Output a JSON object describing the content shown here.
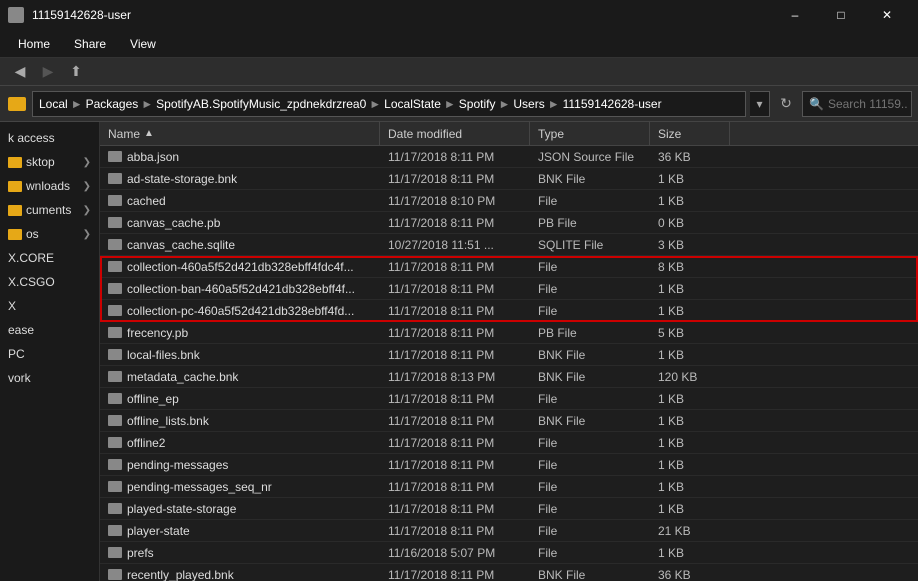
{
  "titleBar": {
    "icon": "folder",
    "title": "11159142628-user",
    "controls": [
      "minimize",
      "maximize",
      "close"
    ]
  },
  "menuBar": {
    "items": [
      "Home",
      "Share",
      "View"
    ]
  },
  "toolbar": {
    "label": "File Explorer Toolbar"
  },
  "addressBar": {
    "parts": [
      "Local",
      "Packages",
      "SpotifyAB.SpotifyMusic_zpdnekdrzrea0",
      "LocalState",
      "Spotify",
      "Users",
      "11159142628-user"
    ],
    "search_placeholder": "Search 11159..."
  },
  "sidebar": {
    "items": [
      {
        "label": "k access",
        "hasArrow": false
      },
      {
        "label": "sktop",
        "hasArrow": true
      },
      {
        "label": "wnloads",
        "hasArrow": true
      },
      {
        "label": "cuments",
        "hasArrow": true
      },
      {
        "label": "os",
        "hasArrow": true
      },
      {
        "label": "X.CORE",
        "hasArrow": false
      },
      {
        "label": "X.CSGO",
        "hasArrow": false
      },
      {
        "label": "X",
        "hasArrow": false
      },
      {
        "label": "ease",
        "hasArrow": false
      },
      {
        "label": "PC",
        "hasArrow": false
      },
      {
        "label": "vork",
        "hasArrow": false
      }
    ]
  },
  "columns": [
    {
      "label": "Name",
      "key": "name"
    },
    {
      "label": "Date modified",
      "key": "date"
    },
    {
      "label": "Type",
      "key": "type"
    },
    {
      "label": "Size",
      "key": "size"
    }
  ],
  "files": [
    {
      "name": "abba.json",
      "date": "11/17/2018 8:11 PM",
      "type": "JSON Source File",
      "size": "36 KB",
      "highlighted": false,
      "isFolder": false
    },
    {
      "name": "ad-state-storage.bnk",
      "date": "11/17/2018 8:11 PM",
      "type": "BNK File",
      "size": "1 KB",
      "highlighted": false,
      "isFolder": false
    },
    {
      "name": "cached",
      "date": "11/17/2018 8:10 PM",
      "type": "File",
      "size": "1 KB",
      "highlighted": false,
      "isFolder": false
    },
    {
      "name": "canvas_cache.pb",
      "date": "11/17/2018 8:11 PM",
      "type": "PB File",
      "size": "0 KB",
      "highlighted": false,
      "isFolder": false
    },
    {
      "name": "canvas_cache.sqlite",
      "date": "10/27/2018 11:51 ...",
      "type": "SQLITE File",
      "size": "3 KB",
      "highlighted": false,
      "isFolder": false
    },
    {
      "name": "collection-460a5f52d421db328ebff4fdc4f...",
      "date": "11/17/2018 8:11 PM",
      "type": "File",
      "size": "8 KB",
      "highlighted": true,
      "isFolder": false
    },
    {
      "name": "collection-ban-460a5f52d421db328ebff4f...",
      "date": "11/17/2018 8:11 PM",
      "type": "File",
      "size": "1 KB",
      "highlighted": true,
      "isFolder": false
    },
    {
      "name": "collection-pc-460a5f52d421db328ebff4fd...",
      "date": "11/17/2018 8:11 PM",
      "type": "File",
      "size": "1 KB",
      "highlighted": true,
      "isFolder": false
    },
    {
      "name": "frecency.pb",
      "date": "11/17/2018 8:11 PM",
      "type": "PB File",
      "size": "5 KB",
      "highlighted": false,
      "isFolder": false
    },
    {
      "name": "local-files.bnk",
      "date": "11/17/2018 8:11 PM",
      "type": "BNK File",
      "size": "1 KB",
      "highlighted": false,
      "isFolder": false
    },
    {
      "name": "metadata_cache.bnk",
      "date": "11/17/2018 8:13 PM",
      "type": "BNK File",
      "size": "120 KB",
      "highlighted": false,
      "isFolder": false
    },
    {
      "name": "offline_ep",
      "date": "11/17/2018 8:11 PM",
      "type": "File",
      "size": "1 KB",
      "highlighted": false,
      "isFolder": false
    },
    {
      "name": "offline_lists.bnk",
      "date": "11/17/2018 8:11 PM",
      "type": "BNK File",
      "size": "1 KB",
      "highlighted": false,
      "isFolder": false
    },
    {
      "name": "offline2",
      "date": "11/17/2018 8:11 PM",
      "type": "File",
      "size": "1 KB",
      "highlighted": false,
      "isFolder": false
    },
    {
      "name": "pending-messages",
      "date": "11/17/2018 8:11 PM",
      "type": "File",
      "size": "1 KB",
      "highlighted": false,
      "isFolder": false
    },
    {
      "name": "pending-messages_seq_nr",
      "date": "11/17/2018 8:11 PM",
      "type": "File",
      "size": "1 KB",
      "highlighted": false,
      "isFolder": false
    },
    {
      "name": "played-state-storage",
      "date": "11/17/2018 8:11 PM",
      "type": "File",
      "size": "1 KB",
      "highlighted": false,
      "isFolder": false
    },
    {
      "name": "player-state",
      "date": "11/17/2018 8:11 PM",
      "type": "File",
      "size": "21 KB",
      "highlighted": false,
      "isFolder": false
    },
    {
      "name": "prefs",
      "date": "11/16/2018 5:07 PM",
      "type": "File",
      "size": "1 KB",
      "highlighted": false,
      "isFolder": false
    },
    {
      "name": "recently_played.bnk",
      "date": "11/17/2018 8:11 PM",
      "type": "BNK File",
      "size": "36 KB",
      "highlighted": false,
      "isFolder": false
    }
  ],
  "statusBar": {
    "text": ""
  }
}
